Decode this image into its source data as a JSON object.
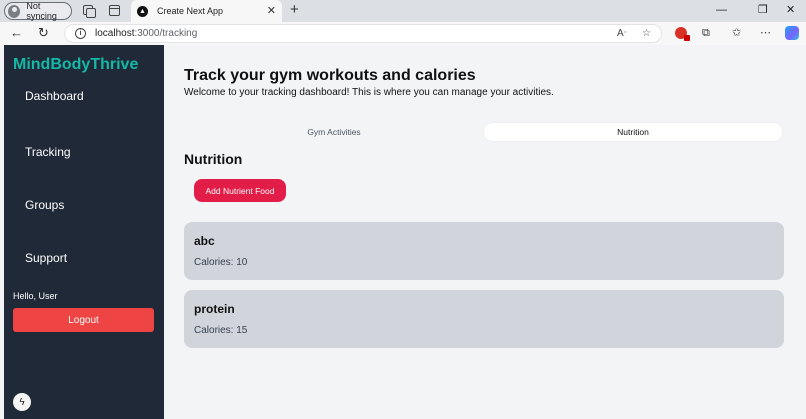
{
  "browser": {
    "profile_label": "Not syncing",
    "tab_title": "Create Next App",
    "tab_favicon": "▲",
    "url_host": "localhost",
    "url_path": ":3000/tracking",
    "icons": [
      "profile-icon",
      "workspaces-icon",
      "tab-actions-icon",
      "close-icon",
      "new-tab-icon",
      "minimize-icon",
      "restore-icon",
      "window-close-icon",
      "back-icon",
      "reload-icon",
      "info-icon",
      "read-aloud-icon",
      "favorite-icon",
      "extension-icon",
      "puzzle-icon",
      "favorites-icon",
      "more-icon",
      "copilot-icon"
    ]
  },
  "sidebar": {
    "brand": "MindBodyThrive",
    "items": [
      {
        "label": "Dashboard"
      },
      {
        "label": "Tracking"
      },
      {
        "label": "Groups"
      },
      {
        "label": "Support"
      }
    ],
    "greeting": "Hello, User",
    "logout_label": "Logout"
  },
  "main": {
    "title": "Track your gym workouts and calories",
    "subtitle": "Welcome to your tracking dashboard! This is where you can manage your activities.",
    "tabs": [
      {
        "label": "Gym Activities",
        "active": false
      },
      {
        "label": "Nutrition",
        "active": true
      }
    ],
    "section_title": "Nutrition",
    "add_button_label": "Add Nutrient Food",
    "foods": [
      {
        "name": "abc",
        "calories_text": "Calories: 10"
      },
      {
        "name": "protein",
        "calories_text": "Calories: 15"
      }
    ]
  },
  "colors": {
    "sidebar_bg": "#1f2937",
    "brand": "#14b8a6",
    "logout": "#ef4444",
    "add_button": "#e11d48",
    "card_bg": "#d1d5db",
    "page_bg": "#f3f4f6"
  }
}
